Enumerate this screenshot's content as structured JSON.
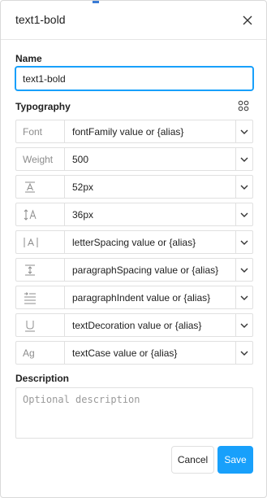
{
  "dialog": {
    "title": "text1-bold",
    "accent_color": "#18a0fb"
  },
  "name_section": {
    "label": "Name",
    "value": "text1-bold"
  },
  "typography": {
    "label": "Typography",
    "rows": [
      {
        "label": "Font",
        "icon": null,
        "value": "fontFamily value or {alias}"
      },
      {
        "label": "Weight",
        "icon": null,
        "value": "500"
      },
      {
        "label": "",
        "icon": "font-size-icon",
        "value": "52px"
      },
      {
        "label": "",
        "icon": "line-height-icon",
        "value": "36px"
      },
      {
        "label": "",
        "icon": "letter-spacing-icon",
        "value": "letterSpacing value or {alias}"
      },
      {
        "label": "",
        "icon": "paragraph-spacing-icon",
        "value": "paragraphSpacing value or {alias}"
      },
      {
        "label": "",
        "icon": "paragraph-indent-icon",
        "value": "paragraphIndent value or {alias}"
      },
      {
        "label": "",
        "icon": "text-decoration-icon",
        "value": "textDecoration value or {alias}"
      },
      {
        "label": "Ag",
        "icon": "text-case-icon",
        "value": "textCase value or {alias}"
      }
    ]
  },
  "description": {
    "label": "Description",
    "placeholder": "Optional description"
  },
  "footer": {
    "cancel_label": "Cancel",
    "save_label": "Save"
  }
}
